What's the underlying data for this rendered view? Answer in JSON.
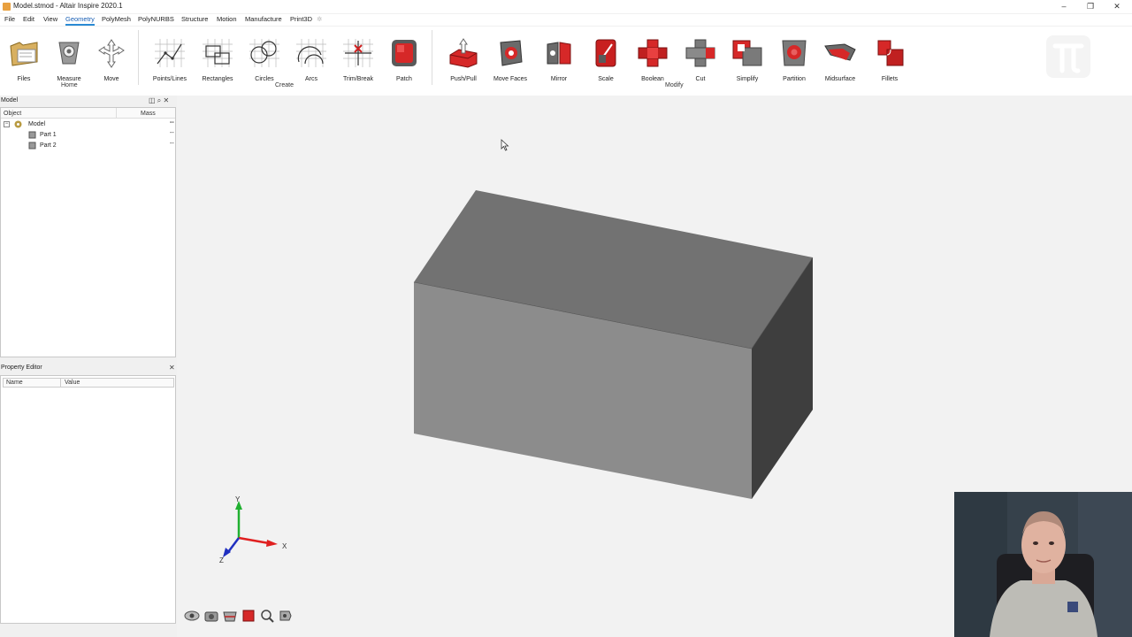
{
  "window": {
    "title": "Model.stmod - Altair Inspire 2020.1",
    "controls": [
      "–",
      "❐",
      "✕"
    ]
  },
  "menu": {
    "items": [
      "File",
      "Edit",
      "View",
      "Geometry",
      "PolyMesh",
      "PolyNURBS",
      "Structure",
      "Motion",
      "Manufacture",
      "Print3D"
    ],
    "active": "Geometry"
  },
  "ribbon": {
    "tools": {
      "files": "Files",
      "measure": "Measure",
      "move": "Move",
      "points_lines": "Points/Lines",
      "rectangles": "Rectangles",
      "circles": "Circles",
      "arcs": "Arcs",
      "trim_break": "Trim/Break",
      "patch": "Patch",
      "push_pull": "Push/Pull",
      "move_faces": "Move Faces",
      "mirror": "Mirror",
      "scale": "Scale",
      "boolean": "Boolean",
      "cut": "Cut",
      "simplify": "Simplify",
      "partition": "Partition",
      "midsurface": "Midsurface",
      "fillets": "Fillets"
    },
    "groups": {
      "home": "Home",
      "create": "Create",
      "modify": "Modify"
    }
  },
  "model_panel": {
    "title": "Model",
    "columns": {
      "object": "Object",
      "mass": "Mass"
    },
    "tree": {
      "root": "Model",
      "children": [
        "Part 1",
        "Part 2"
      ],
      "mass_placeholder": "--"
    }
  },
  "property_editor": {
    "title": "Property Editor",
    "columns": {
      "name": "Name",
      "value": "Value"
    }
  },
  "viewport": {
    "axes": {
      "y": "Y",
      "x": "X",
      "z": "Z"
    },
    "colors": {
      "top_face": "#727272",
      "front_face": "#8c8c8c",
      "side_face": "#3e3e3e"
    }
  }
}
